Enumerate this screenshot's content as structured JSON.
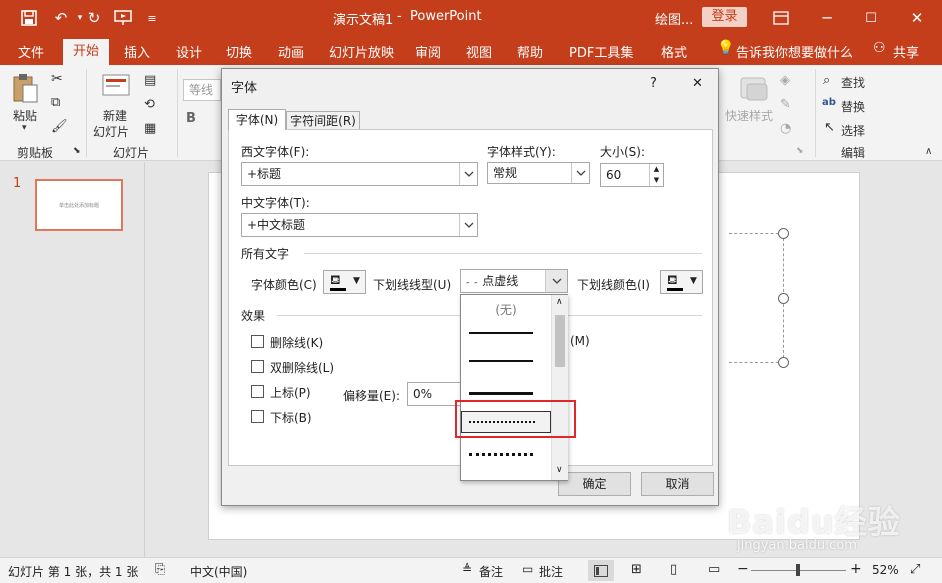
{
  "titlebar": {
    "doc_title": "演示文稿1",
    "separator": "-",
    "app_name": "PowerPoint",
    "context": "绘图...",
    "login": "登录",
    "qat_more": "≡"
  },
  "tabs": [
    "文件",
    "开始",
    "插入",
    "设计",
    "切换",
    "动画",
    "幻灯片放映",
    "审阅",
    "视图",
    "帮助",
    "PDF工具集",
    "格式"
  ],
  "tellme": "告诉我你想要做什么",
  "share": "共享",
  "ribbon": {
    "paste": "粘贴",
    "clipboard": "剪贴板",
    "new_slide": "新建\n幻灯片",
    "new_slide_l1": "新建",
    "new_slide_l2": "幻灯片",
    "slides_group": "幻灯片",
    "font_box": "等线",
    "quick_styles": "快速样式",
    "find": "查找",
    "replace": "替换",
    "select": "选择",
    "editing": "编辑"
  },
  "thumbnail": {
    "number": "1",
    "text": "单击此处添加标题"
  },
  "dialog": {
    "title": "字体",
    "help": "?",
    "close": "✕",
    "tab_font": "字体(N)",
    "tab_spacing": "字符间距(R)",
    "western_font_label": "西文字体(F):",
    "western_font_value": "+标题",
    "style_label": "字体样式(Y):",
    "style_value": "常规",
    "size_label": "大小(S):",
    "size_value": "60",
    "chinese_font_label": "中文字体(T):",
    "chinese_font_value": "+中文标题",
    "all_text": "所有文字",
    "font_color_label": "字体颜色(C)",
    "underline_style_label": "下划线线型(U)",
    "underline_style_value": "点虚线",
    "underline_color_label": "下划线颜色(I)",
    "effects": "效果",
    "strikethrough": "删除线(K)",
    "double_strike": "双删除线(L)",
    "superscript": "上标(P)",
    "subscript": "下标(B)",
    "offset_label": "偏移量(E):",
    "offset_value": "0%",
    "equalize_tail": "(M)",
    "ok": "确定",
    "cancel": "取消",
    "dropdown_none": "(无)"
  },
  "status": {
    "slide_info": "幻灯片 第 1 张，共 1 张",
    "language": "中文(中国)",
    "notes": "备注",
    "comments": "批注",
    "zoom": "52%",
    "zoom_minus": "−",
    "zoom_plus": "+"
  },
  "colors": {
    "accent": "#c43e1c",
    "highlight": "#e0282c"
  },
  "watermark": {
    "text": "Baidu经验",
    "url_text": "jingyan.baidu.com"
  }
}
